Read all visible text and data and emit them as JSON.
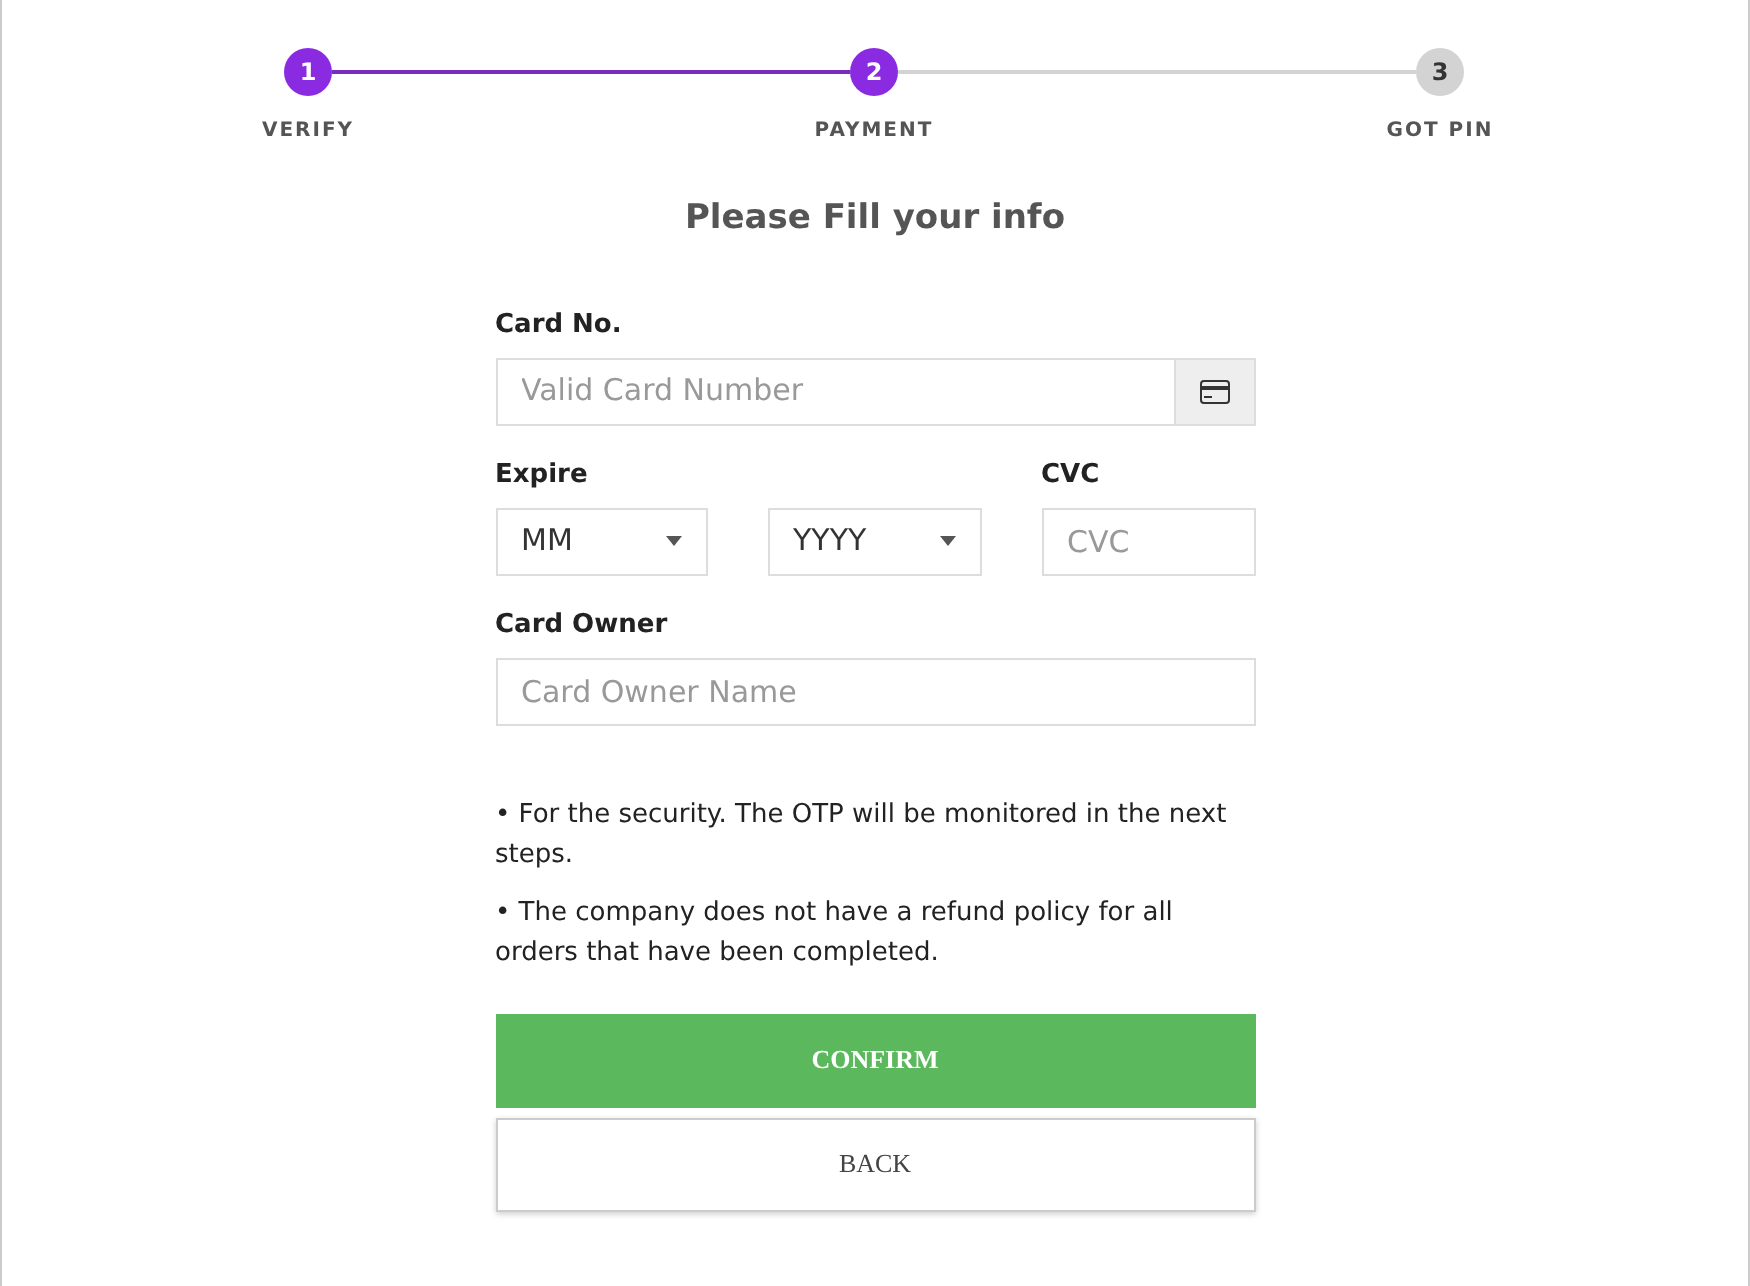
{
  "steps": [
    {
      "number": "1",
      "label": "VERIFY",
      "completed": true
    },
    {
      "number": "2",
      "label": "PAYMENT",
      "completed": true
    },
    {
      "number": "3",
      "label": "GOT PIN",
      "completed": false
    }
  ],
  "title": "Please Fill your info",
  "card_number": {
    "label": "Card No.",
    "placeholder": "Valid Card Number"
  },
  "expire": {
    "label": "Expire",
    "month": "MM",
    "year": "YYYY"
  },
  "cvc": {
    "label": "CVC",
    "placeholder": "CVC"
  },
  "card_owner": {
    "label": "Card Owner",
    "placeholder": "Card Owner Name"
  },
  "notes": [
    "• For the security. The OTP will be monitored in the next steps.",
    "• The company does not have a refund policy for all orders that have been completed."
  ],
  "buttons": [
    {
      "label": "CONFIRM",
      "kind": "primary"
    },
    {
      "label": "BACK",
      "kind": "secondary"
    }
  ]
}
